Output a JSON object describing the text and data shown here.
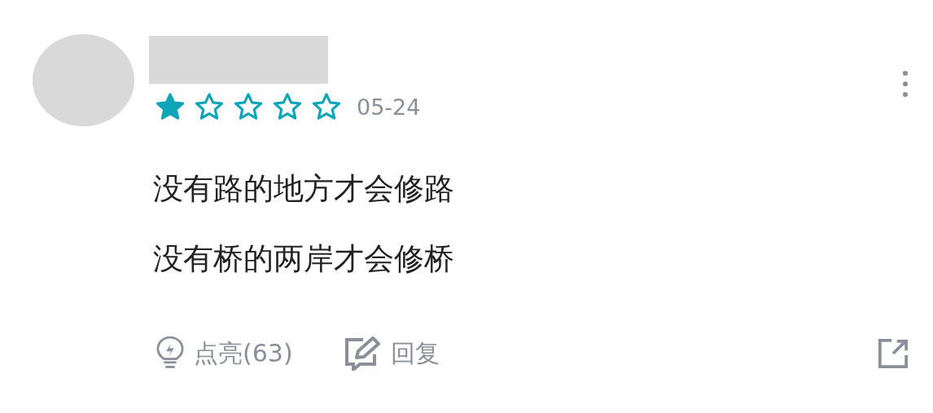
{
  "review": {
    "stars": 1,
    "date": "05-24",
    "lines": [
      "没有路的地方才会修路",
      "没有桥的两岸才会修桥"
    ]
  },
  "actions": [
    {
      "kind": "like",
      "label": "点亮(63)"
    },
    {
      "kind": "reply",
      "label": "回复"
    }
  ]
}
